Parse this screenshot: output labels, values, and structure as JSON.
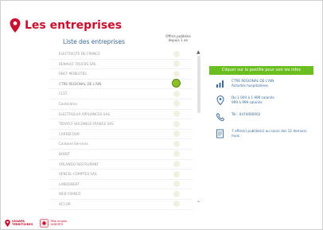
{
  "header": {
    "title": "Les entreprises"
  },
  "list": {
    "title": "Liste des entreprises",
    "offers_header": "Offres publiées depuis 1 an",
    "companies": [
      "ELECTRICITE DE FRANCE",
      "RENAULT TRUCKS SAS",
      "SNCF MOBILITES",
      "CTRE REGIONAL DE L'AIN",
      "CLST",
      "Castorama",
      "ELECTROLUX APPLIANCES SAS",
      "TERAFLY HOLDINGS FRANCE SAS",
      "CARREFOUR",
      "Cantorel Services",
      "BOBST",
      "VOLANDO RESTAURANT",
      "VENCEL COMPTES SAS",
      "LANDOBERT",
      "WEB FRANCE",
      "ACCOR"
    ],
    "selected_index": 3
  },
  "panel": {
    "banner": "Cliquer sur la pastille pour voir les infos",
    "company_line1": "CTRE REGIONAL DE L'AIN",
    "company_line2": "Activités hospitalières",
    "size_line1": "De 1 000 à 1 999 salariés",
    "size_line2": "999 à 999 salariés",
    "phone": "Tél : 0474000002",
    "offers_line1": "7 offre(s) publiée(s) au cours des 12 derniers",
    "offers_line2": "mois"
  },
  "footer": {
    "logo1_line1": "VISIAPA",
    "logo1_line2": "TERRITOIRES",
    "logo2_line1": "Pôle emploi",
    "logo2_line2": "ALBERTE"
  },
  "colors": {
    "brand_red": "#c8102e",
    "accent_green": "#6bbe1f",
    "link_blue": "#3a6a9a"
  }
}
